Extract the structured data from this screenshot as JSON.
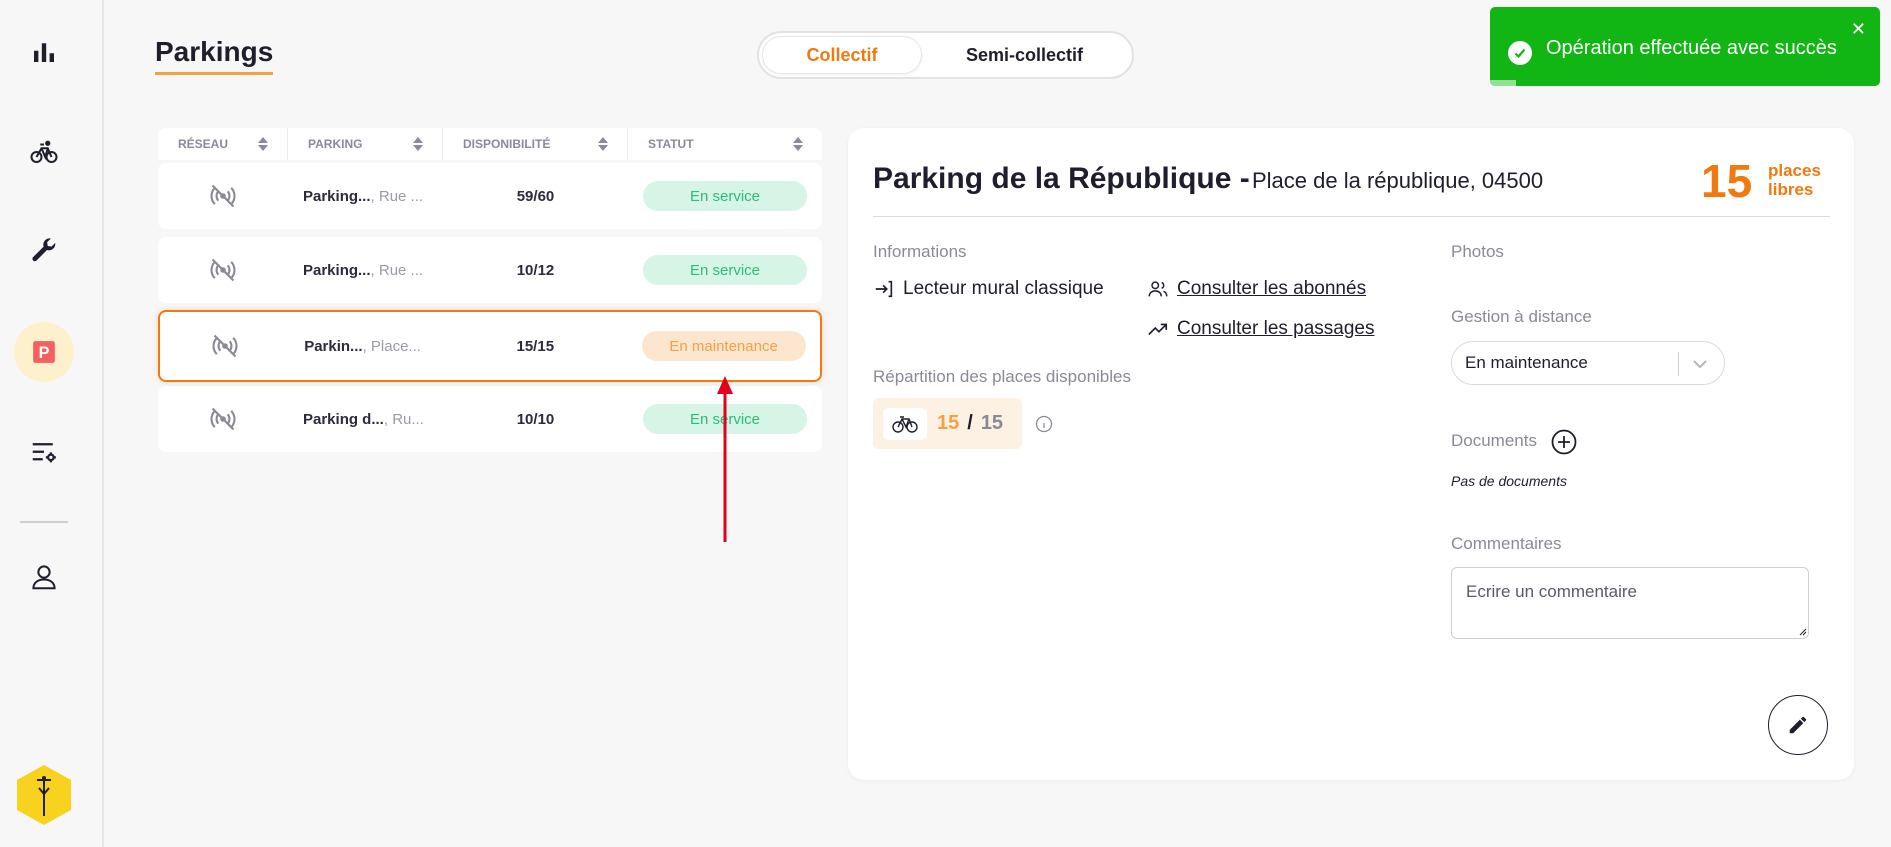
{
  "page": {
    "title": "Parkings",
    "tabs": [
      {
        "label": "Collectif",
        "active": true
      },
      {
        "label": "Semi-collectif",
        "active": false
      }
    ]
  },
  "sidebar": {
    "items": [
      {
        "name": "stats",
        "icon": "bar-chart-icon"
      },
      {
        "name": "bikes",
        "icon": "bicycle-icon"
      },
      {
        "name": "maintenance",
        "icon": "wrench-icon"
      },
      {
        "name": "parkings",
        "icon": "parking-icon",
        "active": true
      },
      {
        "name": "settings",
        "icon": "list-settings-icon"
      },
      {
        "name": "account",
        "icon": "user-icon"
      }
    ]
  },
  "toast": {
    "message": "Opération effectuée avec succès",
    "color": "#12b614"
  },
  "table": {
    "columns": [
      "RÉSEAU",
      "PARKING",
      "DISPONIBILITÉ",
      "STATUT"
    ],
    "rows": [
      {
        "network_icon": "no-signal-icon",
        "name": "Parking...",
        "address": ", Rue ...",
        "availability": "59/60",
        "status": "En service",
        "status_type": "ok"
      },
      {
        "network_icon": "no-signal-icon",
        "name": "Parking...",
        "address": ", Rue ...",
        "availability": "10/12",
        "status": "En service",
        "status_type": "ok"
      },
      {
        "network_icon": "no-signal-icon",
        "name": "Parkin...",
        "address": ", Place...",
        "availability": "15/15",
        "status": "En maintenance",
        "status_type": "maintenance",
        "selected": true
      },
      {
        "network_icon": "no-signal-icon",
        "name": "Parking d...",
        "address": ", Ru...",
        "availability": "10/10",
        "status": "En service",
        "status_type": "ok"
      }
    ]
  },
  "detail": {
    "name": "Parking de la République -",
    "address": "Place de la république, 04500",
    "free_count": "15",
    "free_label_1": "places",
    "free_label_2": "libres",
    "informations_label": "Informations",
    "reader": "Lecteur mural classique",
    "subscribers_link": "Consulter les abonnés",
    "passages_link": "Consulter les passages",
    "repartition_label": "Répartition des places disponibles",
    "repartition_available": "15",
    "repartition_separator": "/",
    "repartition_total": "15",
    "photos_label": "Photos",
    "remote_label": "Gestion à distance",
    "remote_value": "En maintenance",
    "documents_label": "Documents",
    "no_documents": "Pas de documents",
    "comments_label": "Commentaires",
    "comment_placeholder": "Ecrire un commentaire"
  },
  "colors": {
    "accent": "#f07a10",
    "status_ok_bg": "#d6f5e6",
    "status_ok_text": "#2dbb78",
    "status_maint_bg": "#fde6cf",
    "status_maint_text": "#f5a142",
    "annotation_arrow": "#e3001b"
  }
}
